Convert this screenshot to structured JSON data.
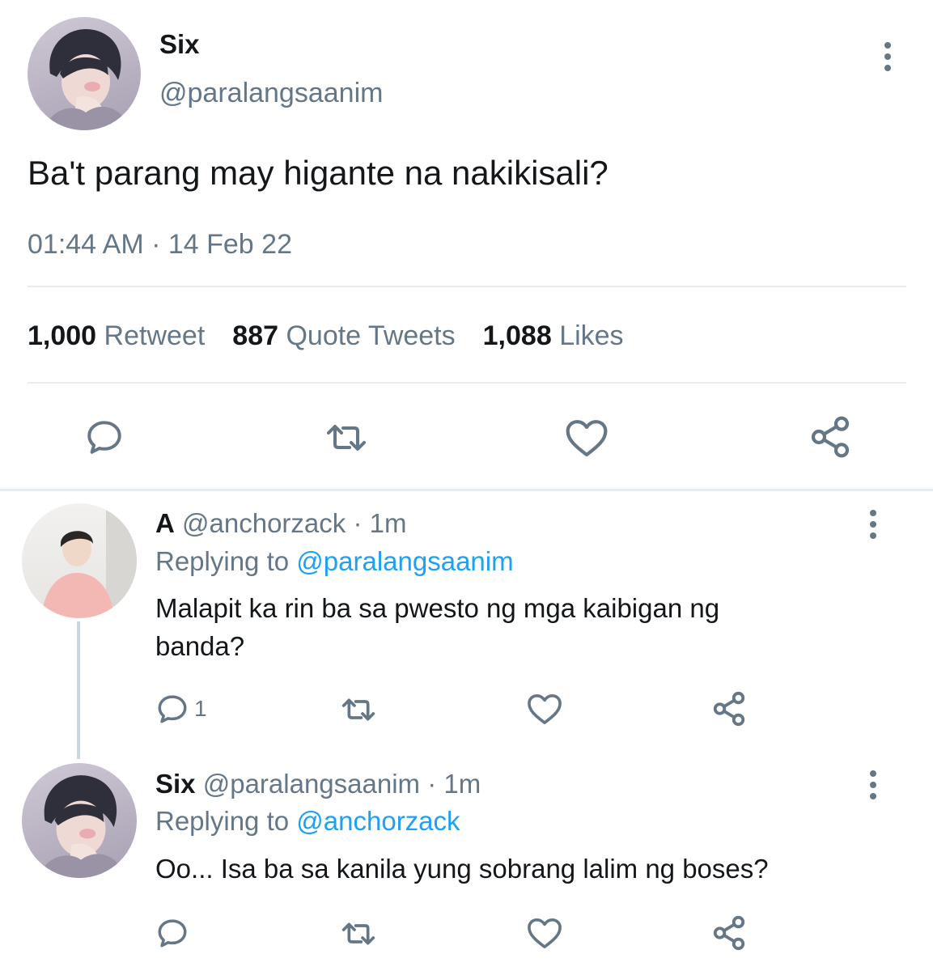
{
  "colors": {
    "text": "#14171a",
    "secondary": "#657786",
    "link": "#1da1f2",
    "divider": "#e6ecf0",
    "background": "#ffffff"
  },
  "main_tweet": {
    "display_name": "Six",
    "handle": "@paralangsaanim",
    "text": "Ba't parang may higante na nakikisali?",
    "timestamp": "01:44 AM · 14 Feb 22",
    "stats": [
      {
        "count": "1,000",
        "label": "Retweet"
      },
      {
        "count": "887",
        "label": "Quote Tweets"
      },
      {
        "count": "1,088",
        "label": "Likes"
      }
    ],
    "actions": [
      "reply-icon",
      "retweet-icon",
      "like-icon",
      "share-icon"
    ]
  },
  "replies": [
    {
      "display_name": "A",
      "handle": "@anchorzack",
      "time": "· 1m",
      "replying_prefix": "Replying to",
      "replying_to": "@paralangsaanim",
      "text_line1": "Malapit ka rin ba sa pwesto ng mga kaibigan ng",
      "text_line2": "banda?",
      "reply_count": "1"
    },
    {
      "display_name": "Six",
      "handle": "@paralangsaanim",
      "time": "· 1m",
      "replying_prefix": "Replying to",
      "replying_to": "@anchorzack",
      "text_line1": "Oo... Isa ba sa kanila yung sobrang lalim ng boses?",
      "reply_count": ""
    }
  ]
}
